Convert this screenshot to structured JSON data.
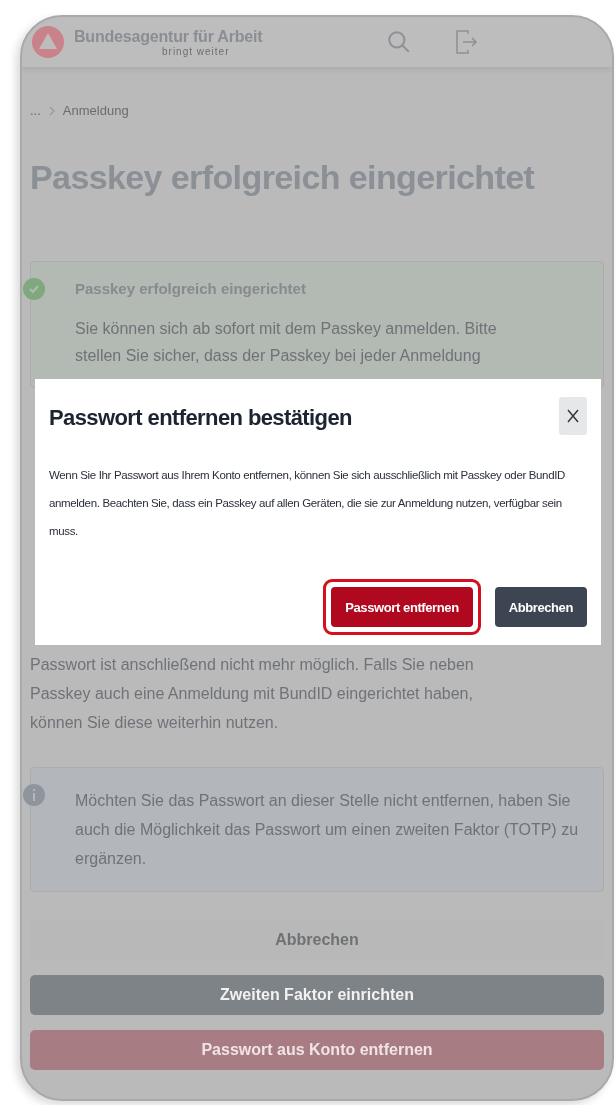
{
  "header": {
    "brand": "Bundesagentur für Arbeit",
    "tagline": "bringt weiter"
  },
  "breadcrumb": {
    "ellipsis": "...",
    "current": "Anmeldung"
  },
  "title": "Passkey erfolgreich eingerichtet",
  "success_alert": {
    "title": "Passkey erfolgreich eingerichtet",
    "lines": [
      "Sie können sich ab sofort mit dem Passkey anmelden. Bitte",
      "stellen Sie sicher, dass der Passkey bei jeder Anmeldung"
    ]
  },
  "paragraph_lines": [
    "Passwort ist anschließend nicht mehr möglich. Falls Sie neben",
    "Passkey auch eine Anmeldung mit BundID eingerichtet haben,",
    "können Sie diese weiterhin nutzen."
  ],
  "info_alert": {
    "text": "Möchten Sie das Passwort an dieser Stelle nicht entfernen, haben Sie auch die Möglichkeit das Passwort um einen zweiten Faktor (TOTP) zu ergänzen."
  },
  "buttons": [
    {
      "label": "Abbrechen",
      "kind": "light"
    },
    {
      "label": "Zweiten Faktor einrichten",
      "kind": "grey"
    },
    {
      "label": "Passwort aus Konto entfernen",
      "kind": "danger"
    }
  ],
  "dialog": {
    "title": "Passwort entfernen bestätigen",
    "text": "Wenn Sie Ihr Passwort aus Ihrem Konto entfernen, können Sie sich ausschließlich mit Passkey oder BundID anmelden. Beachten Sie, dass ein Passkey auf allen Geräten, die sie zur Anmeldung nutzen, verfügbar sein muss.",
    "buttons": [
      {
        "label": "Passwort entfernen",
        "kind": "danger",
        "focused": true
      },
      {
        "label": "Abbrechen",
        "kind": "dark",
        "focused": false
      }
    ]
  }
}
